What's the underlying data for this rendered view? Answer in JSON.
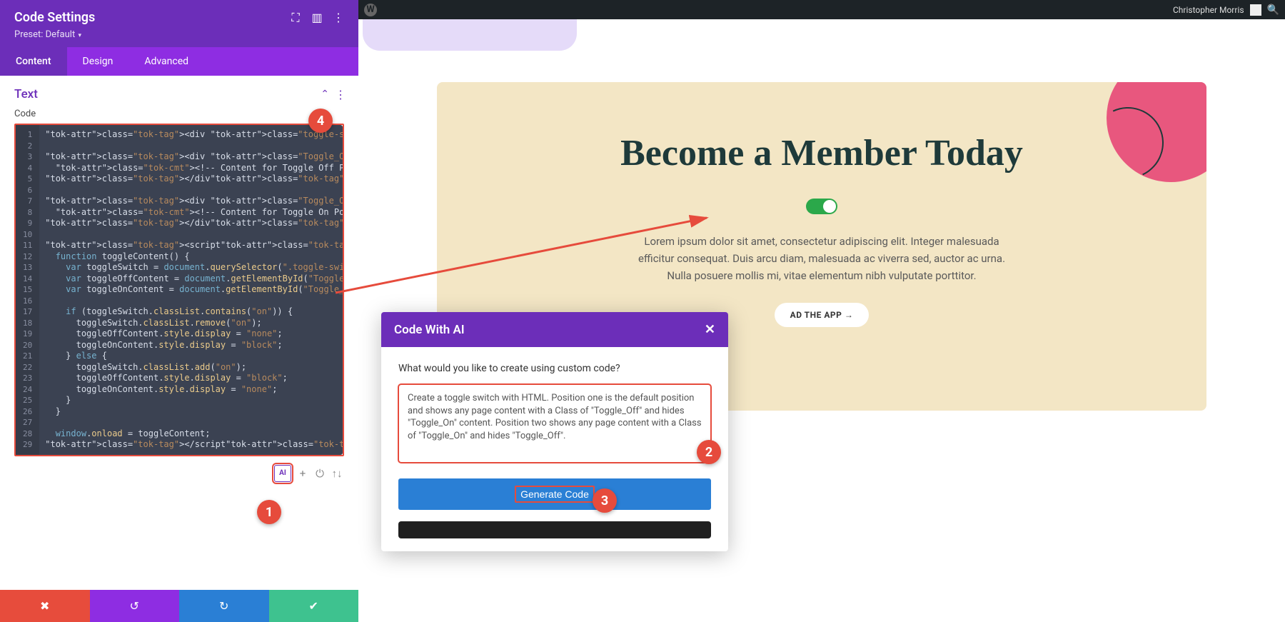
{
  "panel": {
    "title": "Code Settings",
    "preset_prefix": "Preset: ",
    "preset_value": "Default"
  },
  "tabs": {
    "content": "Content",
    "design": "Design",
    "advanced": "Advanced"
  },
  "text_section": {
    "title": "Text",
    "field_label": "Code"
  },
  "code_lines": [
    "<div class=\"toggle-switch on\" onclick=\"toggleContent()\"></div>",
    "",
    "<div class=\"Toggle_Off\">",
    "  <!-- Content for Toggle Off Position -->",
    "</div>",
    "",
    "<div class=\"Toggle_On\" style=\"display: none\">",
    "  <!-- Content for Toggle On Position -->",
    "</div>",
    "",
    "<script>",
    "  function toggleContent() {",
    "    var toggleSwitch = document.querySelector(\".toggle-switch\");",
    "    var toggleOffContent = document.getElementById(\"Toggle_Off\");",
    "    var toggleOnContent = document.getElementById(\"Toggle_On\");",
    "",
    "    if (toggleSwitch.classList.contains(\"on\")) {",
    "      toggleSwitch.classList.remove(\"on\");",
    "      toggleOffContent.style.display = \"none\";",
    "      toggleOnContent.style.display = \"block\";",
    "    } else {",
    "      toggleSwitch.classList.add(\"on\");",
    "      toggleOffContent.style.display = \"block\";",
    "      toggleOnContent.style.display = \"none\";",
    "    }",
    "  }",
    "",
    "  window.onload = toggleContent;",
    "</script>"
  ],
  "editor_footer": {
    "ai": "AI"
  },
  "topbar": {
    "user": "Christopher Morris"
  },
  "preview": {
    "title": "Become a Member Today",
    "paragraph": "Lorem ipsum dolor sit amet, consectetur adipiscing elit. Integer malesuada efficitur consequat. Duis arcu diam, malesuada ac viverra sed, auctor ac urna. Nulla posuere mollis mi, vitae elementum nibh vulputate porttitor.",
    "cta": "AD THE APP →"
  },
  "ai_modal": {
    "title": "Code With AI",
    "question": "What would you like to create using custom code?",
    "prompt": "Create a toggle switch with HTML. Position one is the default position and shows any page content with a Class of \"Toggle_Off\" and hides \"Toggle_On\" content. Position two shows any page content with a Class of \"Toggle_On\" and hides \"Toggle_Off\".",
    "generate": "Generate Code"
  },
  "annotations": {
    "1": "1",
    "2": "2",
    "3": "3",
    "4": "4"
  }
}
